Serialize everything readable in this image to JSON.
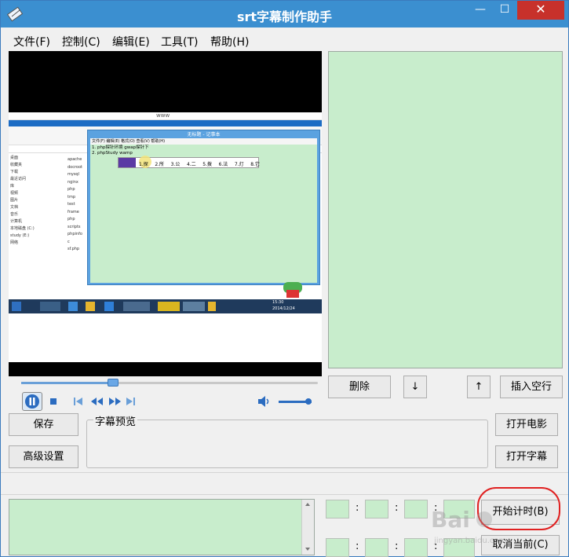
{
  "window": {
    "title": "srt字幕制作助手",
    "min_glyph": "—",
    "max_glyph": "☐",
    "close_glyph": "✕"
  },
  "menu": [
    "文件(F)",
    "控制(C)",
    "编辑(E)",
    "工具(T)",
    "帮助(H)"
  ],
  "player": {
    "seek_progress": 0.31,
    "volume_level": 1.0
  },
  "buttons": {
    "delete": "删除",
    "down": "↓",
    "up": "↑",
    "insert_blank": "插入空行",
    "save": "保存",
    "advanced": "高级设置",
    "open_movie": "打开电影",
    "open_subtitle": "打开字幕",
    "start_timing": "开始计时(B)",
    "cancel_current": "取消当前(C)"
  },
  "preview": {
    "label": "字幕预览"
  },
  "time_separator": ":",
  "video_content": {
    "window_title": "www",
    "notepad_title": "无标题 - 记事本",
    "notepad_menu": "文件(F)  编辑(E)  格式(O)  查看(V)  帮助(H)",
    "line1": "1. php探针环境 gwap探针下",
    "line2": "2. phpStudy wamp",
    "ime_items": [
      "1.探",
      "2.所",
      "3.公",
      "4.二",
      "5.拨",
      "6.法",
      "7.灯",
      "8.它"
    ],
    "files": [
      "apache",
      "docroot",
      "mysql",
      "nginx",
      "php",
      "tmp",
      "test",
      "frame",
      "php",
      "scripts",
      "phpinfo",
      "c",
      "sf.php"
    ],
    "tree": [
      "桌面",
      "收藏夹",
      "下载",
      "最近访问",
      "库",
      "视频",
      "图片",
      "文档",
      "音乐",
      "计算机",
      "本地磁盘 (C:)",
      "study (E:)",
      "网络"
    ],
    "taskbar_time": "2014/12/24",
    "taskbar_clock": "15:30"
  },
  "colors": {
    "titlebar": "#3b8fd0",
    "close": "#c7312b",
    "panel": "#c8edcc",
    "highlight": "#e02020"
  }
}
